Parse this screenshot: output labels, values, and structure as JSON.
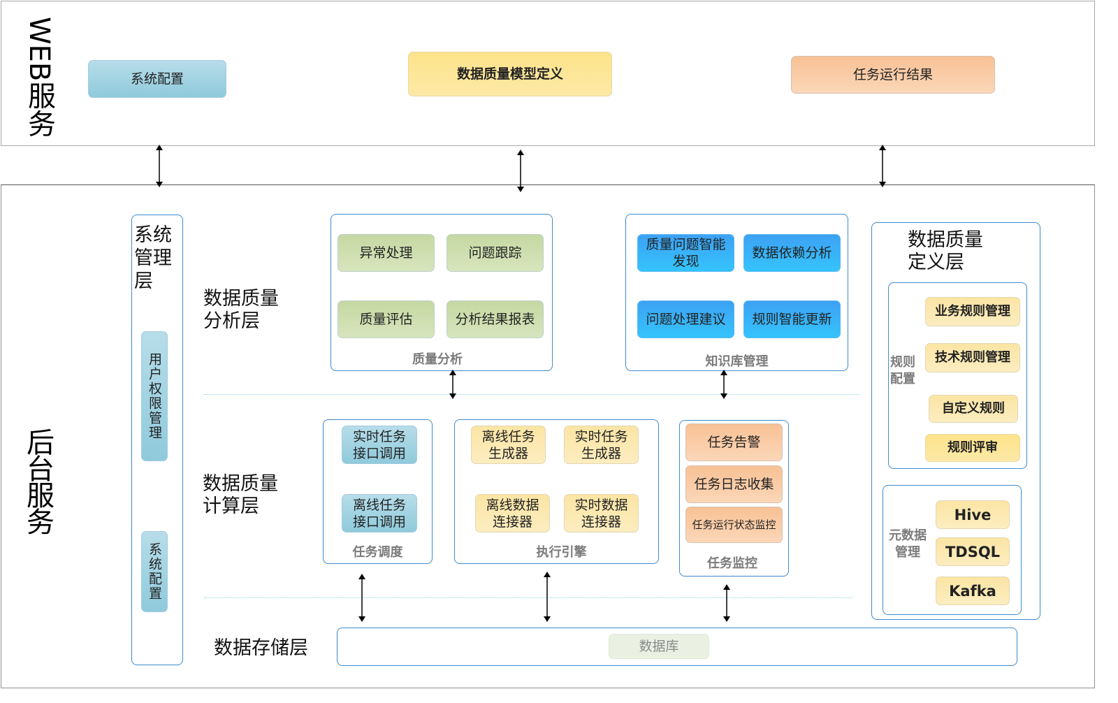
{
  "web": {
    "title": "WEB服务",
    "buttons": [
      {
        "label": "系统配置"
      },
      {
        "label": "数据质量模型定义"
      },
      {
        "label": "任务运行结果"
      }
    ]
  },
  "backend": {
    "title": "后台服务",
    "system_mgmt": {
      "title": "系统管理层",
      "items": [
        {
          "label": "用户权限管理"
        },
        {
          "label": "系统配置"
        }
      ]
    },
    "layers": {
      "analysis": "数据质量分析层",
      "compute": "数据质量计算层",
      "storage": "数据存储层"
    },
    "quality_analysis": {
      "caption": "质量分析",
      "items": [
        {
          "label": "异常处理"
        },
        {
          "label": "问题跟踪"
        },
        {
          "label": "质量评估"
        },
        {
          "label": "分析结果报表"
        }
      ]
    },
    "knowledge_base": {
      "caption": "知识库管理",
      "items": [
        {
          "label": "质量问题智能发现"
        },
        {
          "label": "数据依赖分析"
        },
        {
          "label": "问题处理建议"
        },
        {
          "label": "规则智能更新"
        }
      ]
    },
    "task_scheduling": {
      "caption": "任务调度",
      "items": [
        {
          "label": "实时任务接口调用"
        },
        {
          "label": "离线任务接口调用"
        }
      ]
    },
    "execution_engine": {
      "caption": "执行引擎",
      "items": [
        {
          "label": "离线任务生成器"
        },
        {
          "label": "实时任务生成器"
        },
        {
          "label": "离线数据连接器"
        },
        {
          "label": "实时数据连接器"
        }
      ]
    },
    "task_monitoring": {
      "caption": "任务监控",
      "items": [
        {
          "label": "任务告警"
        },
        {
          "label": "任务日志收集"
        },
        {
          "label": "任务运行状态监控"
        }
      ]
    },
    "definition_layer": {
      "title": "数据质量定义层",
      "rule_config": {
        "caption": "规则配置",
        "items": [
          {
            "label": "业务规则管理"
          },
          {
            "label": "技术规则管理"
          },
          {
            "label": "自定义规则"
          },
          {
            "label": "规则评审"
          }
        ]
      },
      "metadata_mgmt": {
        "caption": "元数据管理",
        "items": [
          {
            "label": "Hive"
          },
          {
            "label": "TDSQL"
          },
          {
            "label": "Kafka"
          }
        ]
      }
    },
    "storage": {
      "database": "数据库"
    }
  }
}
